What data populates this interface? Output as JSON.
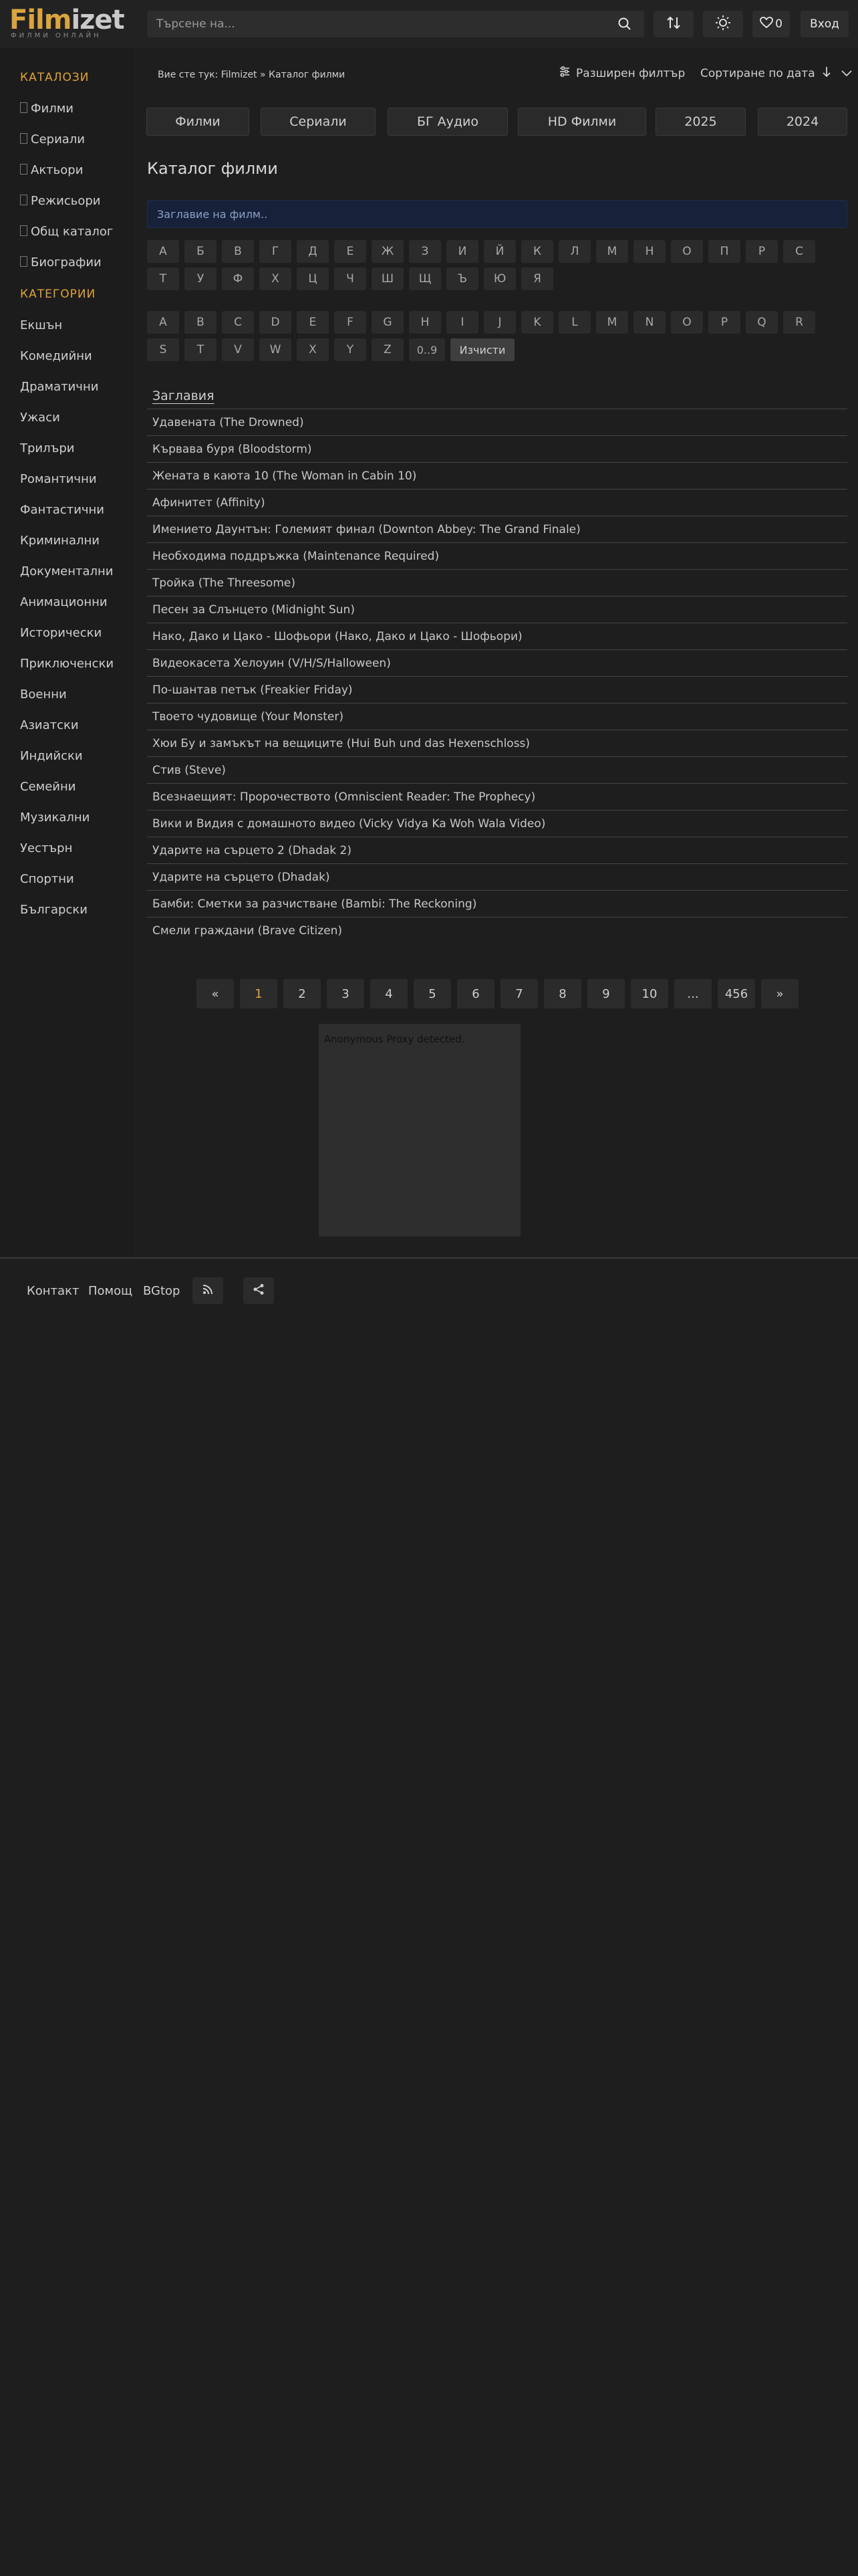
{
  "header": {
    "logo_main_a": "Film",
    "logo_main_b": "izet",
    "logo_sub": "ФИЛМИ ОНЛАЙН",
    "search_placeholder": "Търсене на...",
    "favorites_count": "0",
    "login_label": "Вход"
  },
  "sidebar": {
    "catalogs_heading": "КАТАЛОЗИ",
    "catalogs": [
      "Филми",
      "Сериали",
      "Актьори",
      "Режисьори",
      "Общ каталог",
      "Биографии"
    ],
    "categories_heading": "КАТЕГОРИИ",
    "categories": [
      "Екшън",
      "Комедийни",
      "Драматични",
      "Ужаси",
      "Трилъри",
      "Романтични",
      "Фантастични",
      "Криминални",
      "Документални",
      "Анимационни",
      "Исторически",
      "Приключенски",
      "Военни",
      "Азиатски",
      "Индийски",
      "Семейни",
      "Музикални",
      "Уестърн",
      "Спортни",
      "Български"
    ]
  },
  "breadcrumb": {
    "prefix": "Вие сте тук:",
    "home": "Filmizet",
    "separator": "»",
    "current": "Каталог филми"
  },
  "controls": {
    "advanced_filter": "Разширен  филтър",
    "sort_label": "Сортиране по дата"
  },
  "category_buttons": [
    "Филми",
    "Сериали",
    "БГ Аудио",
    "HD Филми",
    "2025",
    "2024"
  ],
  "page_title": "Каталог филми",
  "title_input_placeholder": "Заглавие на филм..",
  "cyrillic_letters_row1": [
    "А",
    "Б",
    "В",
    "Г",
    "Д",
    "Е",
    "Ж",
    "З",
    "И",
    "Й",
    "К",
    "Л",
    "М",
    "Н",
    "О",
    "П",
    "Р",
    "С"
  ],
  "cyrillic_letters_row2": [
    "Т",
    "У",
    "Ф",
    "Х",
    "Ц",
    "Ч",
    "Ш",
    "Щ",
    "Ъ",
    "Ю",
    "Я"
  ],
  "latin_letters_row1": [
    "A",
    "B",
    "C",
    "D",
    "E",
    "F",
    "G",
    "H",
    "I",
    "J",
    "K",
    "L",
    "M",
    "N",
    "O",
    "P",
    "Q",
    "R"
  ],
  "latin_letters_row2": [
    "S",
    "T",
    "V",
    "W",
    "X",
    "Y",
    "Z",
    "0..9"
  ],
  "clear_label": "Изчисти",
  "list_heading": "Заглавия",
  "titles": [
    "Удавената (The Drowned)",
    "Кървава буря (Bloodstorm)",
    "Жената в каюта 10 (The Woman in Cabin 10)",
    "Афинитет (Affinity)",
    "Имението Даунтън: Големият финал (Downton Abbey: The Grand Finale)",
    "Необходима поддръжка (Maintenance Required)",
    "Тройка (The Threesome)",
    "Песен за Слънцето (Midnight Sun)",
    "Нако, Дако и Цако - Шофьори (Нако, Дако и Цако - Шофьори)",
    "Видеокасета Хелоуин (V/H/S/Halloween)",
    "По-шантав петък (Freakier Friday)",
    "Твоето чудовище (Your Monster)",
    "Хюи Бу и замъкът на вещиците (Hui Buh und das Hexenschloss)",
    "Стив (Steve)",
    "Всезнаещият: Пророчеството (Omniscient Reader: The Prophecy)",
    "Вики и Видия с домашното видео (Vicky Vidya Ka Woh Wala Video)",
    "Ударите на сърцето 2 (Dhadak 2)",
    "Ударите на сърцето (Dhadak)",
    "Бамби: Сметки за разчистване (Bambi: The Reckoning)",
    "Смели граждани (Brave Citizen)"
  ],
  "pagination": {
    "prev": "«",
    "pages": [
      "1",
      "2",
      "3",
      "4",
      "5",
      "6",
      "7",
      "8",
      "9",
      "10",
      "...",
      "456"
    ],
    "next": "»",
    "current": "1"
  },
  "ad_text": "Anonymous Proxy detected.",
  "footer": {
    "links": [
      "Контакт",
      "Помощ",
      "BGtop"
    ]
  },
  "colors": {
    "accent": "#e0a23a",
    "background": "#1e1e1e",
    "header": "#222222",
    "input_bg": "#17223a"
  }
}
